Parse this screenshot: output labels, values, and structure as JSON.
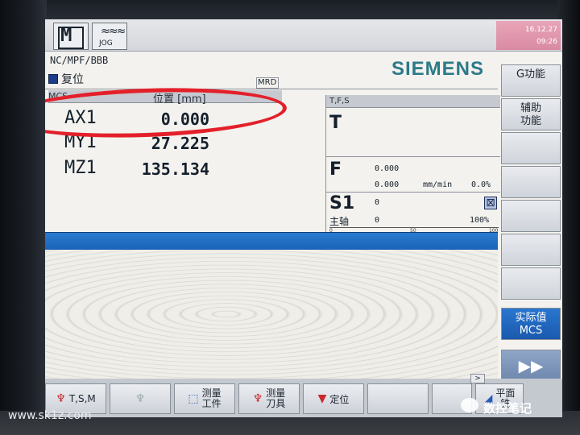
{
  "header": {
    "mode_machine": "M",
    "mode_jog_label": "JOG",
    "mode_jog_wave": "≈≈≈",
    "clock_line1": "16.12.27",
    "clock_line2": "09:26"
  },
  "program_path": "NC/MPF/BBB",
  "brand": "SIEMENS",
  "status": {
    "label": "复位",
    "mrd": "MRD"
  },
  "axis_table": {
    "col_axis": "MCS",
    "col_pos": "位置 [mm]",
    "rows": [
      {
        "name": "AX1",
        "value": "0.000"
      },
      {
        "name": "MY1",
        "value": "27.225"
      },
      {
        "name": "MZ1",
        "value": "135.134"
      }
    ]
  },
  "tfs": {
    "title": "T,F,S",
    "t_label": "T",
    "f_label": "F",
    "f_value1": "0.000",
    "f_value2": "0.000",
    "f_unit": "mm/min",
    "f_percent": "0.0%",
    "s_label": "S1",
    "s_sub": "主轴",
    "s_value1": "0",
    "s_value2": "0",
    "s_percent": "100%",
    "scale": [
      "0",
      "50",
      "100"
    ]
  },
  "vertical_softkeys": [
    {
      "label": "G功能"
    },
    {
      "label": "辅助\n功能"
    },
    {
      "label": "实际值\nMCS"
    },
    {
      "label": "▶▶"
    }
  ],
  "bottom_softkeys": [
    {
      "label": "T,S,M"
    },
    {
      "label": ""
    },
    {
      "label": "测量\n工件"
    },
    {
      "label": "测量\n刀具"
    },
    {
      "label": "定位"
    },
    {
      "label": ""
    },
    {
      "label": ""
    },
    {
      "label": "平面\n铣"
    }
  ],
  "more_arrow": ">",
  "watermark_left": "www.sk1z.com",
  "watermark_right": "数控笔记"
}
